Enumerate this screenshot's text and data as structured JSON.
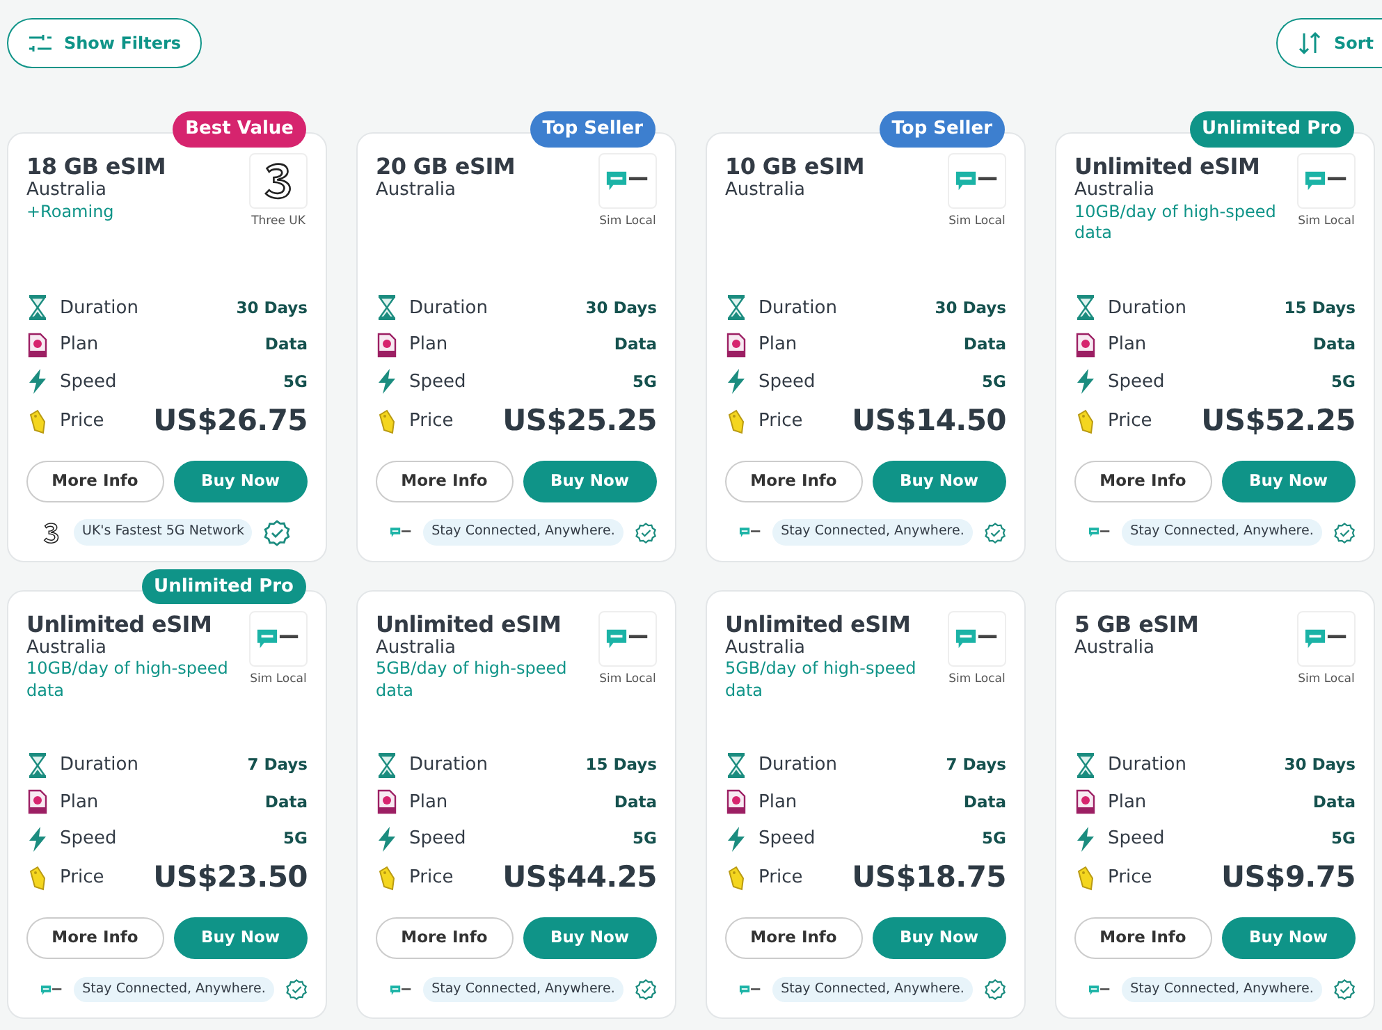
{
  "toolbar": {
    "filter_button": "Show Filters",
    "sort_button": "Sort"
  },
  "cards": [
    {
      "badge": {
        "label": "Best Value",
        "color": "#d6246e"
      },
      "title": "18 GB eSIM",
      "country": "Australia",
      "note": "+Roaming",
      "provider": {
        "kind": "three",
        "name": "Three UK"
      },
      "specs": {
        "duration_label": "Duration",
        "duration": "30 Days",
        "plan_label": "Plan",
        "plan": "Data",
        "speed_label": "Speed",
        "speed": "5G",
        "price_label": "Price",
        "price": "US$26.75"
      },
      "buttons": [
        "More Info",
        "Buy Now"
      ],
      "tagline": "UK's Fastest 5G Network"
    },
    {
      "badge": {
        "label": "Top Seller",
        "color": "#3d7fcf"
      },
      "title": "20 GB eSIM",
      "country": "Australia",
      "provider": {
        "kind": "bubble",
        "name": "Sim Local"
      },
      "specs": {
        "duration_label": "Duration",
        "duration": "30 Days",
        "plan_label": "Plan",
        "plan": "Data",
        "speed_label": "Speed",
        "speed": "5G",
        "price_label": "Price",
        "price": "US$25.25"
      },
      "buttons": [
        "More Info",
        "Buy Now"
      ],
      "tagline": "Stay Connected, Anywhere."
    },
    {
      "badge": {
        "label": "Top Seller",
        "color": "#3d7fcf"
      },
      "title": "10 GB eSIM",
      "country": "Australia",
      "provider": {
        "kind": "bubble",
        "name": "Sim Local"
      },
      "specs": {
        "duration_label": "Duration",
        "duration": "30 Days",
        "plan_label": "Plan",
        "plan": "Data",
        "speed_label": "Speed",
        "speed": "5G",
        "price_label": "Price",
        "price": "US$14.50"
      },
      "buttons": [
        "More Info",
        "Buy Now"
      ],
      "tagline": "Stay Connected, Anywhere."
    },
    {
      "badge": {
        "label": "Unlimited Pro",
        "color": "#0f9488"
      },
      "title": "Unlimited eSIM",
      "country": "Australia",
      "note": "10GB/day of high-speed data",
      "provider": {
        "kind": "bubble",
        "name": "Sim Local"
      },
      "specs": {
        "duration_label": "Duration",
        "duration": "15 Days",
        "plan_label": "Plan",
        "plan": "Data",
        "speed_label": "Speed",
        "speed": "5G",
        "price_label": "Price",
        "price": "US$52.25"
      },
      "buttons": [
        "More Info",
        "Buy Now"
      ],
      "tagline": "Stay Connected, Anywhere."
    },
    {
      "badge": {
        "label": "Unlimited Pro",
        "color": "#0f9488"
      },
      "title": "Unlimited eSIM",
      "country": "Australia",
      "note": "10GB/day of high-speed data",
      "provider": {
        "kind": "bubble",
        "name": "Sim Local"
      },
      "specs": {
        "duration_label": "Duration",
        "duration": "7 Days",
        "plan_label": "Plan",
        "plan": "Data",
        "speed_label": "Speed",
        "speed": "5G",
        "price_label": "Price",
        "price": "US$23.50"
      },
      "buttons": [
        "More Info",
        "Buy Now"
      ],
      "tagline": "Stay Connected, Anywhere."
    },
    {
      "title": "Unlimited eSIM",
      "country": "Australia",
      "note": "5GB/day of high-speed data",
      "provider": {
        "kind": "bubble",
        "name": "Sim Local"
      },
      "specs": {
        "duration_label": "Duration",
        "duration": "15 Days",
        "plan_label": "Plan",
        "plan": "Data",
        "speed_label": "Speed",
        "speed": "5G",
        "price_label": "Price",
        "price": "US$44.25"
      },
      "buttons": [
        "More Info",
        "Buy Now"
      ],
      "tagline": "Stay Connected, Anywhere."
    },
    {
      "title": "Unlimited eSIM",
      "country": "Australia",
      "note": "5GB/day of high-speed data",
      "provider": {
        "kind": "bubble",
        "name": "Sim Local"
      },
      "specs": {
        "duration_label": "Duration",
        "duration": "7 Days",
        "plan_label": "Plan",
        "plan": "Data",
        "speed_label": "Speed",
        "speed": "5G",
        "price_label": "Price",
        "price": "US$18.75"
      },
      "buttons": [
        "More Info",
        "Buy Now"
      ],
      "tagline": "Stay Connected, Anywhere."
    },
    {
      "title": "5 GB eSIM",
      "country": "Australia",
      "provider": {
        "kind": "bubble",
        "name": "Sim Local"
      },
      "specs": {
        "duration_label": "Duration",
        "duration": "30 Days",
        "plan_label": "Plan",
        "plan": "Data",
        "speed_label": "Speed",
        "speed": "5G",
        "price_label": "Price",
        "price": "US$9.75"
      },
      "buttons": [
        "More Info",
        "Buy Now"
      ],
      "tagline": "Stay Connected, Anywhere."
    }
  ]
}
